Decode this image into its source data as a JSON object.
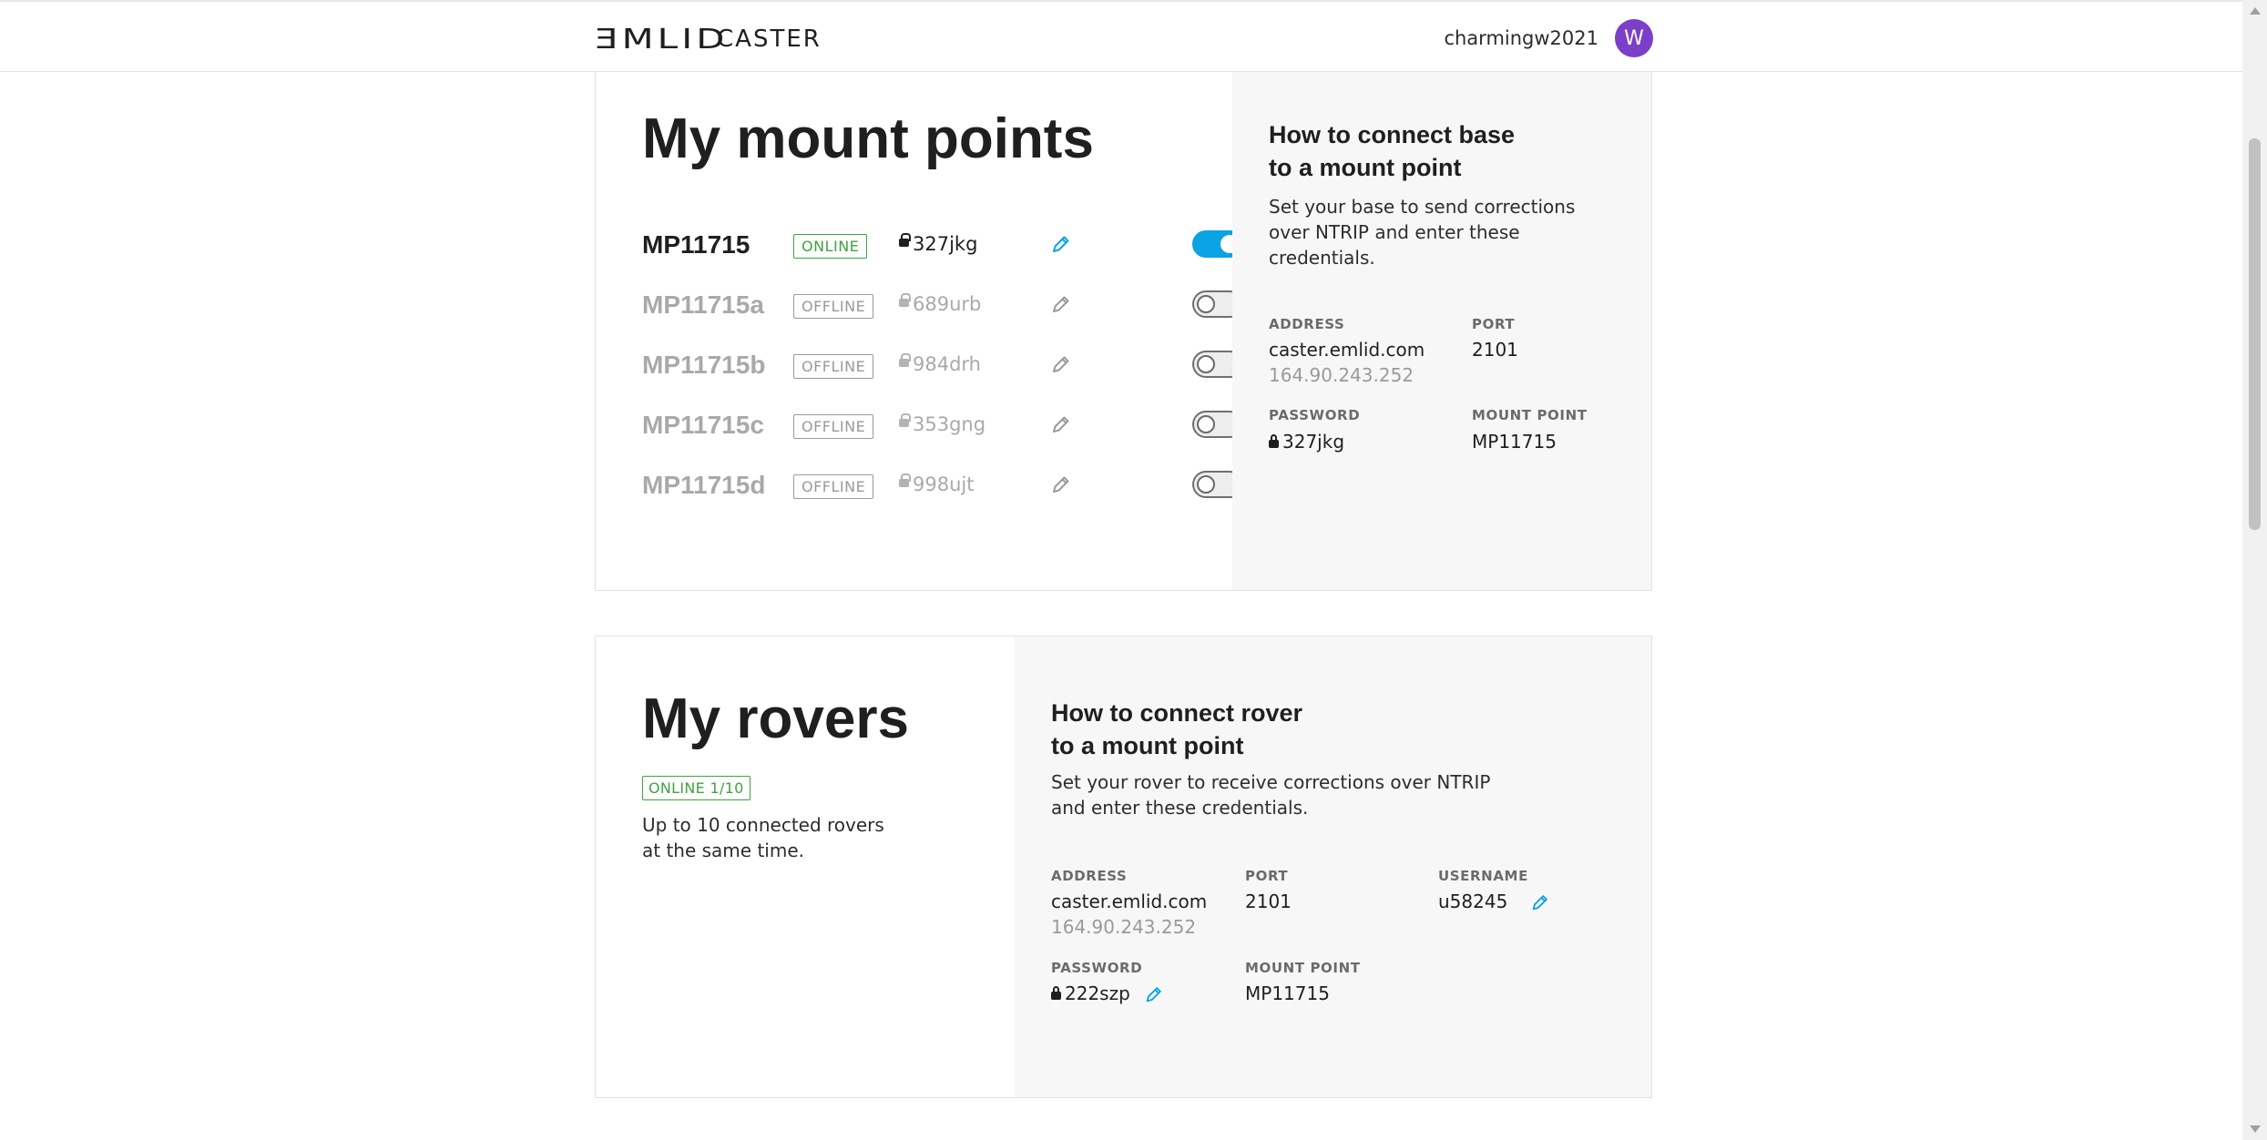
{
  "header": {
    "logo_mark": "ƎMLID",
    "logo_text": "CASTER",
    "username": "charmingw2021",
    "avatar_initial": "W"
  },
  "mount_points": {
    "title": "My mount points",
    "items": [
      {
        "name": "MP11715",
        "status": "ONLINE",
        "password": "327jkg",
        "enabled": true
      },
      {
        "name": "MP11715a",
        "status": "OFFLINE",
        "password": "689urb",
        "enabled": false
      },
      {
        "name": "MP11715b",
        "status": "OFFLINE",
        "password": "984drh",
        "enabled": false
      },
      {
        "name": "MP11715c",
        "status": "OFFLINE",
        "password": "353gng",
        "enabled": false
      },
      {
        "name": "MP11715d",
        "status": "OFFLINE",
        "password": "998ujt",
        "enabled": false
      }
    ],
    "help": {
      "title_line1": "How to connect base",
      "title_line2": "to a mount point",
      "desc_line1": "Set your base to send corrections",
      "desc_line2": "over NTRIP and enter these",
      "desc_line3": "credentials.",
      "address_label": "ADDRESS",
      "address": "caster.emlid.com",
      "ip": "164.90.243.252",
      "port_label": "PORT",
      "port": "2101",
      "password_label": "PASSWORD",
      "password": "327jkg",
      "mountpoint_label": "MOUNT POINT",
      "mountpoint": "MP11715"
    }
  },
  "rovers": {
    "title": "My rovers",
    "badge": "ONLINE 1/10",
    "desc_line1": "Up to 10 connected rovers",
    "desc_line2": "at the same time.",
    "help": {
      "title_line1": "How to connect rover",
      "title_line2": "to a mount point",
      "desc_line1": "Set your rover to receive corrections over NTRIP",
      "desc_line2": "and enter these credentials.",
      "address_label": "ADDRESS",
      "address": "caster.emlid.com",
      "ip": "164.90.243.252",
      "port_label": "PORT",
      "port": "2101",
      "username_label": "USERNAME",
      "username": "u58245",
      "password_label": "PASSWORD",
      "password": "222szp",
      "mountpoint_label": "MOUNT POINT",
      "mountpoint": "MP11715"
    }
  },
  "colors": {
    "accent": "#0aa3e3",
    "online": "#3fa33f",
    "avatar": "#7b3fc9"
  }
}
